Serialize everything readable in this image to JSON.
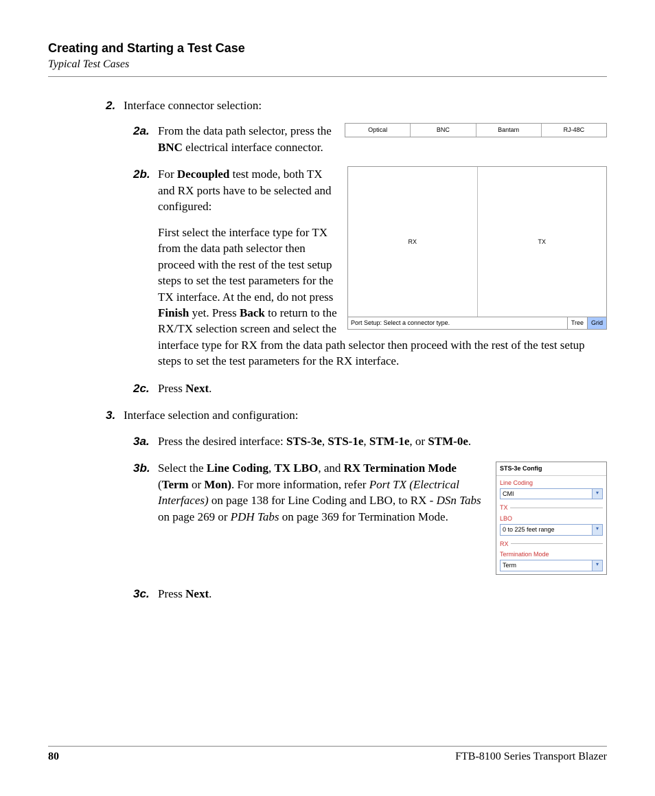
{
  "header": {
    "title": "Creating and Starting a Test Case",
    "subtitle": "Typical Test Cases"
  },
  "steps": {
    "s2": {
      "num": "2.",
      "text": "Interface connector selection:",
      "a": {
        "num": "2a.",
        "t1": "From the data path selector, press the ",
        "b1": "BNC",
        "t2": " electrical interface connector."
      },
      "b": {
        "num": "2b.",
        "t1": "For ",
        "b1": "Decoupled",
        "t2": " test mode, both TX and RX ports have to be selected and configured:",
        "p2a": "First select the interface type for TX from the data path selector then proceed with the ",
        "p2b": "rest of the test setup steps to set the test parameters for the TX interface. At the end, do not press ",
        "b2": "Finish",
        "p2c": " yet. Press ",
        "b3": "Back",
        "p2d": " to return to the RX/TX selection screen and select the interface type for RX from the data path selector then proceed with the rest of the test setup steps to set the test parameters for the RX interface."
      },
      "c": {
        "num": "2c.",
        "t1": "Press ",
        "b1": "Next",
        "t2": "."
      }
    },
    "s3": {
      "num": "3.",
      "text": "Interface selection and configuration:",
      "a": {
        "num": "3a.",
        "t1": "Press the desired interface: ",
        "b1": "STS-3e",
        "c1": ", ",
        "b2": "STS-1e",
        "c2": ", ",
        "b3": "STM-1e",
        "c3": ", or ",
        "b4": "STM-0e",
        "c4": "."
      },
      "b": {
        "num": "3b.",
        "t1": "Select the ",
        "b1": "Line Coding",
        "c1": ", ",
        "b2": "TX LBO",
        "c2": ", and ",
        "b3": "RX Termination Mode",
        "c3": " (",
        "b4": "Term",
        "c4": " or ",
        "b5": "Mon)",
        "c5": ". For more information, refer ",
        "i1": "Port TX (Electrical Interfaces)",
        "c6": " on page 138 for Line Coding and LBO, to RX - ",
        "i2": "DSn Tabs",
        "c7": " on page 269 or ",
        "i3": "PDH Tabs",
        "c8": " on page 369 for Termination Mode."
      },
      "c": {
        "num": "3c.",
        "t1": "Press ",
        "b1": "Next",
        "t2": "."
      }
    }
  },
  "fig1": {
    "c1": "Optical",
    "c2": "BNC",
    "c3": "Bantam",
    "c4": "RJ-48C"
  },
  "fig2": {
    "rx": "RX",
    "tx": "TX",
    "msg": "Port Setup: Select a connector type.",
    "tree": "Tree",
    "grid": "Grid"
  },
  "fig3": {
    "title": "STS-3e Config",
    "lineCodingLabel": "Line Coding",
    "lineCodingVal": "CMI",
    "txLabel": "TX",
    "lboLabel": "LBO",
    "lboVal": "0 to 225 feet range",
    "rxLabel": "RX",
    "termLabel": "Termination Mode",
    "termVal": "Term"
  },
  "footer": {
    "page": "80",
    "book": "FTB-8100 Series Transport Blazer"
  }
}
